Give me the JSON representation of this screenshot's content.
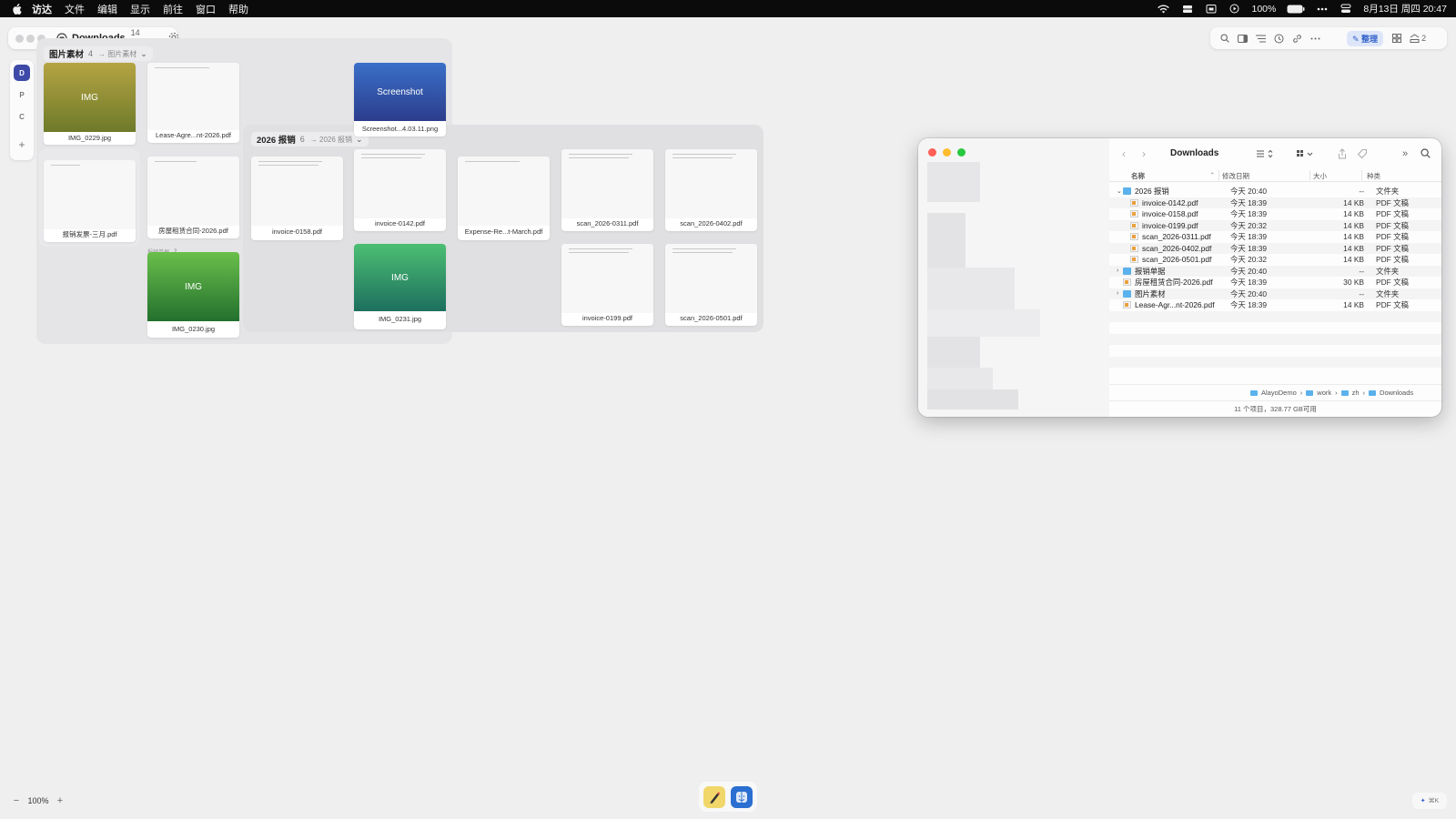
{
  "menubar": {
    "app_name": "访达",
    "menus": [
      "文件",
      "编辑",
      "显示",
      "前往",
      "窗口",
      "帮助"
    ],
    "battery": "100%",
    "datetime": "8月13日 周四 20:47"
  },
  "canvas": {
    "toolbar": {
      "title": "Downloads",
      "count": "14 项"
    },
    "rail": [
      "D",
      "P",
      "C",
      "+"
    ],
    "right_toolbar": {
      "organize_label": "整理",
      "badge": "2"
    },
    "zoom": {
      "minus": "−",
      "value": "100%",
      "plus": "+"
    },
    "corner_hint": "⌘K",
    "groups": [
      {
        "name": "图片素材",
        "count": "4",
        "path": "→ 图片素材"
      },
      {
        "name": "2026 报销",
        "count": "6",
        "path": "→ 2026 报销"
      },
      {
        "name": "报销单据",
        "count": "2",
        "path": ""
      }
    ],
    "cards": [
      {
        "label": "IMG_0229.jpg",
        "thumb_text": "IMG",
        "color_top": "#b5a443",
        "color_bottom": "#6e7a2a"
      },
      {
        "label": "Lease-Agre...nt-2026.pdf"
      },
      {
        "label": "报销发票-三月.pdf"
      },
      {
        "label": "房屋租赁合同-2026.pdf"
      },
      {
        "label": "IMG_0230.jpg",
        "thumb_text": "IMG",
        "color_top": "#6abf4b",
        "color_bottom": "#23702e"
      },
      {
        "label": "invoice-0158.pdf"
      },
      {
        "label": "Screenshot...4.03.11.png",
        "thumb_text": "Screenshot",
        "color_top": "#3a6fc8",
        "color_bottom": "#2c3d8c"
      },
      {
        "label": "invoice-0142.pdf"
      },
      {
        "label": "IMG_0231.jpg",
        "thumb_text": "IMG",
        "color_top": "#4cbf73",
        "color_bottom": "#1d6f5e"
      },
      {
        "label": "Expense-Re...t-March.pdf"
      },
      {
        "label": "scan_2026-0311.pdf"
      },
      {
        "label": "scan_2026-0402.pdf"
      },
      {
        "label": "invoice-0199.pdf"
      },
      {
        "label": "scan_2026-0501.pdf"
      }
    ]
  },
  "finder": {
    "title": "Downloads",
    "columns": {
      "name": "名称",
      "date": "修改日期",
      "size": "大小",
      "kind": "种类"
    },
    "rows": [
      {
        "name": "2026 报销",
        "date": "今天 20:40",
        "size": "--",
        "kind": "文件夹",
        "type": "folder",
        "disclosure": "⌄",
        "level": 0
      },
      {
        "name": "invoice-0142.pdf",
        "date": "今天 18:39",
        "size": "14 KB",
        "kind": "PDF 文稿",
        "type": "pdf",
        "disclosure": "",
        "level": 1
      },
      {
        "name": "invoice-0158.pdf",
        "date": "今天 18:39",
        "size": "14 KB",
        "kind": "PDF 文稿",
        "type": "pdf",
        "disclosure": "",
        "level": 1
      },
      {
        "name": "invoice-0199.pdf",
        "date": "今天 20:32",
        "size": "14 KB",
        "kind": "PDF 文稿",
        "type": "pdf",
        "disclosure": "",
        "level": 1
      },
      {
        "name": "scan_2026-0311.pdf",
        "date": "今天 18:39",
        "size": "14 KB",
        "kind": "PDF 文稿",
        "type": "pdf",
        "disclosure": "",
        "level": 1
      },
      {
        "name": "scan_2026-0402.pdf",
        "date": "今天 18:39",
        "size": "14 KB",
        "kind": "PDF 文稿",
        "type": "pdf",
        "disclosure": "",
        "level": 1
      },
      {
        "name": "scan_2026-0501.pdf",
        "date": "今天 20:32",
        "size": "14 KB",
        "kind": "PDF 文稿",
        "type": "pdf",
        "disclosure": "",
        "level": 1
      },
      {
        "name": "报销单据",
        "date": "今天 20:40",
        "size": "--",
        "kind": "文件夹",
        "type": "folder",
        "disclosure": "›",
        "level": 0
      },
      {
        "name": "房屋租赁合同-2026.pdf",
        "date": "今天 18:39",
        "size": "30 KB",
        "kind": "PDF 文稿",
        "type": "pdf",
        "disclosure": "",
        "level": 0
      },
      {
        "name": "图片素材",
        "date": "今天 20:40",
        "size": "--",
        "kind": "文件夹",
        "type": "folder",
        "disclosure": "›",
        "level": 0
      },
      {
        "name": "Lease-Agr...nt-2026.pdf",
        "date": "今天 18:39",
        "size": "14 KB",
        "kind": "PDF 文稿",
        "type": "pdf",
        "disclosure": "",
        "level": 0
      }
    ],
    "path": [
      "AlayoDemo",
      "work",
      "zh",
      "Downloads"
    ],
    "status": "11 个项目，328.77 GB可用"
  }
}
